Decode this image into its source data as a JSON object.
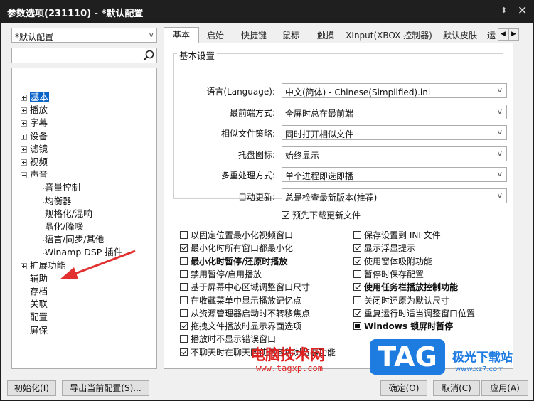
{
  "window": {
    "title": "参数选项(231110) - *默认配置",
    "pin_icon": "pin-icon",
    "close_icon": "close-icon"
  },
  "preset_select": {
    "value": "*默认配置"
  },
  "search": {
    "icon": "search-icon",
    "value": ""
  },
  "tree": [
    {
      "label": "基本",
      "expander": "plus",
      "selected": true
    },
    {
      "label": "播放",
      "expander": "plus"
    },
    {
      "label": "字幕",
      "expander": "plus"
    },
    {
      "label": "设备",
      "expander": "plus"
    },
    {
      "label": "滤镜",
      "expander": "plus"
    },
    {
      "label": "视频",
      "expander": "plus"
    },
    {
      "label": "声音",
      "expander": "minus"
    },
    {
      "label": "音量控制",
      "child": true
    },
    {
      "label": "均衡器",
      "child": true
    },
    {
      "label": "规格化/混响",
      "child": true
    },
    {
      "label": "晶化/降噪",
      "child": true
    },
    {
      "label": "语言/同步/其他",
      "child": true
    },
    {
      "label": "Winamp DSP 插件",
      "child": true
    },
    {
      "label": "扩展功能",
      "expander": "plus"
    },
    {
      "label": "辅助"
    },
    {
      "label": "存档"
    },
    {
      "label": "关联"
    },
    {
      "label": "配置"
    },
    {
      "label": "屏保"
    }
  ],
  "tabs": [
    "基本",
    "启始",
    "快捷键",
    "鼠标",
    "触摸",
    "XInput(XBOX 控制器)",
    "默认皮肤",
    "运"
  ],
  "basic_settings": {
    "group_title": "基本设置",
    "rows": [
      {
        "label": "语言(Language):",
        "value": "中文(简体) - Chinese(Simplified).ini"
      },
      {
        "label": "最前端方式:",
        "value": "全屏时总在最前端"
      },
      {
        "label": "相似文件策略:",
        "value": "同时打开相似文件"
      },
      {
        "label": "托盘图标:",
        "value": "始终显示"
      },
      {
        "label": "多重处理方式:",
        "value": "单个进程即选即播"
      },
      {
        "label": "自动更新:",
        "value": "总是检查最新版本(推荐)"
      }
    ],
    "predownload": {
      "label": "预先下载更新文件",
      "checked": true
    }
  },
  "options_left": [
    {
      "label": "以固定位置最小化视频窗口",
      "checked": false
    },
    {
      "label": "最小化时所有窗口都最小化",
      "checked": true
    },
    {
      "label": "最小化时暂停/还原时播放",
      "checked": false,
      "bold": true
    },
    {
      "label": "禁用暂停/启用播放",
      "checked": false
    },
    {
      "label": "基于屏幕中心区域调整窗口尺寸",
      "checked": false
    },
    {
      "label": "在收藏菜单中显示播放记忆点",
      "checked": false
    },
    {
      "label": "从资源管理器启动时不转移焦点",
      "checked": false
    },
    {
      "label": "拖拽文件播放时显示界面选项",
      "checked": true
    },
    {
      "label": "播放时不显示错误窗口",
      "checked": false
    },
    {
      "label": "不聊天时在聊天区使用各种浏览器功能",
      "checked": true
    }
  ],
  "options_right": [
    {
      "label": "保存设置到 INI 文件",
      "checked": false
    },
    {
      "label": "显示浮显提示",
      "checked": true
    },
    {
      "label": "使用窗体吸附功能",
      "checked": true
    },
    {
      "label": "暂停时保存配置",
      "checked": false
    },
    {
      "label": "使用任务栏播放控制功能",
      "checked": true,
      "bold": true
    },
    {
      "label": "关闭时还原为默认尺寸",
      "checked": false
    },
    {
      "label": "重复运行时适当调整窗口位置",
      "checked": true
    },
    {
      "label": "Windows 锁屏时暂停",
      "indeterminate": true,
      "bold": true
    }
  ],
  "buttons": {
    "init": "初始化(I)",
    "export": "导出当前配置(S)...",
    "ok": "确定(O)",
    "cancel": "取消(C)",
    "apply": "应用(A)"
  },
  "watermark": {
    "site_name": "电脑技术网",
    "site_url": "www.tagxp.com",
    "tag": "TAG",
    "tag_cn": "极光下载站",
    "tag_url": "www.xz7.com"
  }
}
